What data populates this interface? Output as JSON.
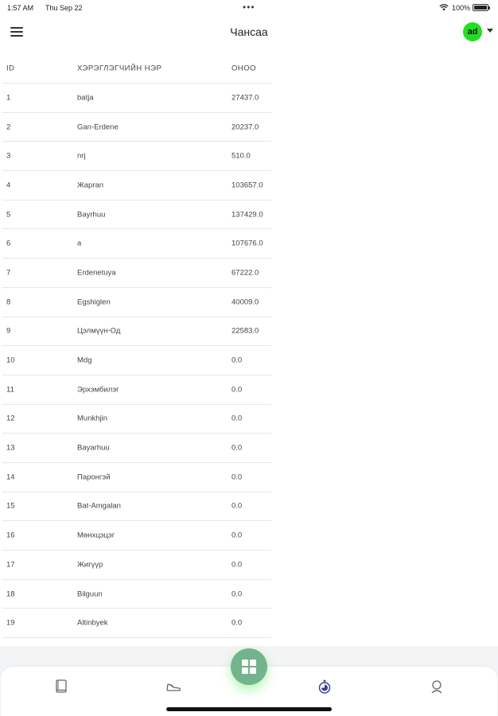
{
  "status_bar": {
    "time": "1:57 AM",
    "date": "Thu Sep 22",
    "battery": "100%"
  },
  "header": {
    "title": "Чансаа",
    "avatar_initials": "ad"
  },
  "table": {
    "columns": [
      "ID",
      "ХЭРЭГЛЭГЧИЙН НЭР",
      "ОНОО"
    ],
    "rows": [
      {
        "id": "1",
        "name": "batja",
        "score": "27437.0"
      },
      {
        "id": "2",
        "name": "Gan-Erdene",
        "score": "20237.0"
      },
      {
        "id": "3",
        "name": "nrj",
        "score": "510.0"
      },
      {
        "id": "4",
        "name": "Жapran",
        "score": "103657.0"
      },
      {
        "id": "5",
        "name": "Bayrhuu",
        "score": "137429.0"
      },
      {
        "id": "6",
        "name": "a",
        "score": "107676.0"
      },
      {
        "id": "7",
        "name": "Erdenetuya",
        "score": "67222.0"
      },
      {
        "id": "8",
        "name": "Egshiglen",
        "score": "40009.0"
      },
      {
        "id": "9",
        "name": "Цэлмүүн-Од",
        "score": "22583.0"
      },
      {
        "id": "10",
        "name": "Mdg",
        "score": "0.0"
      },
      {
        "id": "11",
        "name": "Эрхэмбилэг",
        "score": "0.0"
      },
      {
        "id": "12",
        "name": "Munkhjin",
        "score": "0.0"
      },
      {
        "id": "13",
        "name": "Bayarhuu",
        "score": "0.0"
      },
      {
        "id": "14",
        "name": "Паронгэй",
        "score": "0.0"
      },
      {
        "id": "15",
        "name": "Bat-Amgalan",
        "score": "0.0"
      },
      {
        "id": "16",
        "name": "Мөнхцэцэг",
        "score": "0.0"
      },
      {
        "id": "17",
        "name": "Жигүүр",
        "score": "0.0"
      },
      {
        "id": "18",
        "name": "Bilguun",
        "score": "0.0"
      },
      {
        "id": "19",
        "name": "Altinbyek",
        "score": "0.0"
      },
      {
        "id": "",
        "name": "",
        "score": ""
      }
    ]
  },
  "bottom_nav": {
    "items": [
      {
        "icon": "book-icon"
      },
      {
        "icon": "sneaker-icon"
      },
      {
        "icon": "grid-icon"
      },
      {
        "icon": "stopwatch-icon"
      },
      {
        "icon": "profile-icon"
      }
    ]
  },
  "colors": {
    "avatar": "#22e01f",
    "fab": "#74b48d",
    "nav_active": "#3b3f8f"
  }
}
